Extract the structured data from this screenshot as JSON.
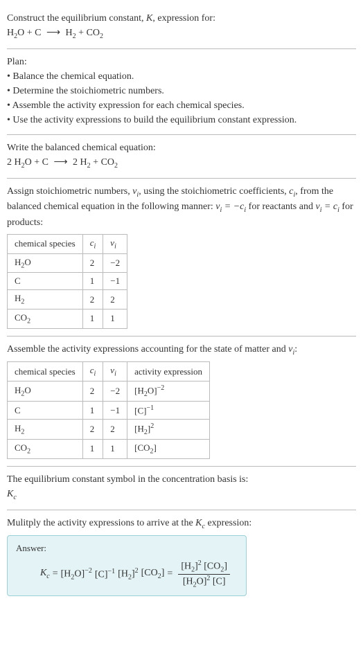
{
  "intro": {
    "line1": "Construct the equilibrium constant, ",
    "k": "K",
    "line1b": ", expression for:",
    "eq_lhs_a": "H",
    "eq_lhs_a_sub": "2",
    "eq_lhs_b": "O + C",
    "arrow": "⟶",
    "eq_rhs_a": "H",
    "eq_rhs_a_sub": "2",
    "eq_rhs_b": " + CO",
    "eq_rhs_b_sub": "2"
  },
  "plan": {
    "title": "Plan:",
    "b1": "• Balance the chemical equation.",
    "b2": "• Determine the stoichiometric numbers.",
    "b3": "• Assemble the activity expression for each chemical species.",
    "b4": "• Use the activity expressions to build the equilibrium constant expression."
  },
  "balanced": {
    "title": "Write the balanced chemical equation:",
    "lhs_a": "2 H",
    "lhs_a_sub": "2",
    "lhs_b": "O + C",
    "arrow": "⟶",
    "rhs_a": "2 H",
    "rhs_a_sub": "2",
    "rhs_b": " + CO",
    "rhs_b_sub": "2"
  },
  "stoich": {
    "text_a": "Assign stoichiometric numbers, ",
    "nu": "ν",
    "i": "i",
    "text_b": ", using the stoichiometric coefficients, ",
    "c": "c",
    "text_c": ", from the balanced chemical equation in the following manner: ",
    "rel1a": "ν",
    "rel1b": " = −c",
    "text_d": " for reactants and ",
    "rel2a": "ν",
    "rel2b": " = c",
    "text_e": " for products:",
    "h_species": "chemical species",
    "h_ci": "c",
    "h_ci_i": "i",
    "h_nu": "ν",
    "h_nu_i": "i",
    "rows": [
      {
        "sp_a": "H",
        "sp_sub": "2",
        "sp_b": "O",
        "ci": "2",
        "nu": "−2"
      },
      {
        "sp_a": "C",
        "sp_sub": "",
        "sp_b": "",
        "ci": "1",
        "nu": "−1"
      },
      {
        "sp_a": "H",
        "sp_sub": "2",
        "sp_b": "",
        "ci": "2",
        "nu": "2"
      },
      {
        "sp_a": "CO",
        "sp_sub": "2",
        "sp_b": "",
        "ci": "1",
        "nu": "1"
      }
    ]
  },
  "activity": {
    "text_a": "Assemble the activity expressions accounting for the state of matter and ",
    "nu": "ν",
    "i": "i",
    "colon": ":",
    "h_species": "chemical species",
    "h_ci": "c",
    "h_ci_i": "i",
    "h_nu": "ν",
    "h_nu_i": "i",
    "h_act": "activity expression",
    "rows": [
      {
        "sp_a": "H",
        "sp_sub": "2",
        "sp_b": "O",
        "ci": "2",
        "nu": "−2",
        "ae_a": "[H",
        "ae_sub": "2",
        "ae_b": "O]",
        "ae_sup": "−2"
      },
      {
        "sp_a": "C",
        "sp_sub": "",
        "sp_b": "",
        "ci": "1",
        "nu": "−1",
        "ae_a": "[C]",
        "ae_sub": "",
        "ae_b": "",
        "ae_sup": "−1"
      },
      {
        "sp_a": "H",
        "sp_sub": "2",
        "sp_b": "",
        "ci": "2",
        "nu": "2",
        "ae_a": "[H",
        "ae_sub": "2",
        "ae_b": "]",
        "ae_sup": "2"
      },
      {
        "sp_a": "CO",
        "sp_sub": "2",
        "sp_b": "",
        "ci": "1",
        "nu": "1",
        "ae_a": "[CO",
        "ae_sub": "2",
        "ae_b": "]",
        "ae_sup": ""
      }
    ]
  },
  "basis": {
    "text": "The equilibrium constant symbol in the concentration basis is:",
    "k": "K",
    "c": "c"
  },
  "final": {
    "text_a": "Mulitply the activity expressions to arrive at the ",
    "k": "K",
    "c": "c",
    "text_b": " expression:",
    "answer": "Answer:",
    "kc_k": "K",
    "kc_c": "c",
    "eq": " = ",
    "t1_a": "[H",
    "t1_sub": "2",
    "t1_b": "O]",
    "t1_sup": "−2",
    "t2_a": "[C]",
    "t2_sup": "−1",
    "t3_a": "[H",
    "t3_sub": "2",
    "t3_b": "]",
    "t3_sup": "2",
    "t4_a": "[CO",
    "t4_sub": "2",
    "t4_b": "]",
    "eq2": " = ",
    "num_a": "[H",
    "num_a_sub": "2",
    "num_a_b": "]",
    "num_a_sup": "2",
    "num_b": "[CO",
    "num_b_sub": "2",
    "num_b_b": "]",
    "den_a": "[H",
    "den_a_sub": "2",
    "den_a_b": "O]",
    "den_a_sup": "2",
    "den_b": "[C]"
  }
}
